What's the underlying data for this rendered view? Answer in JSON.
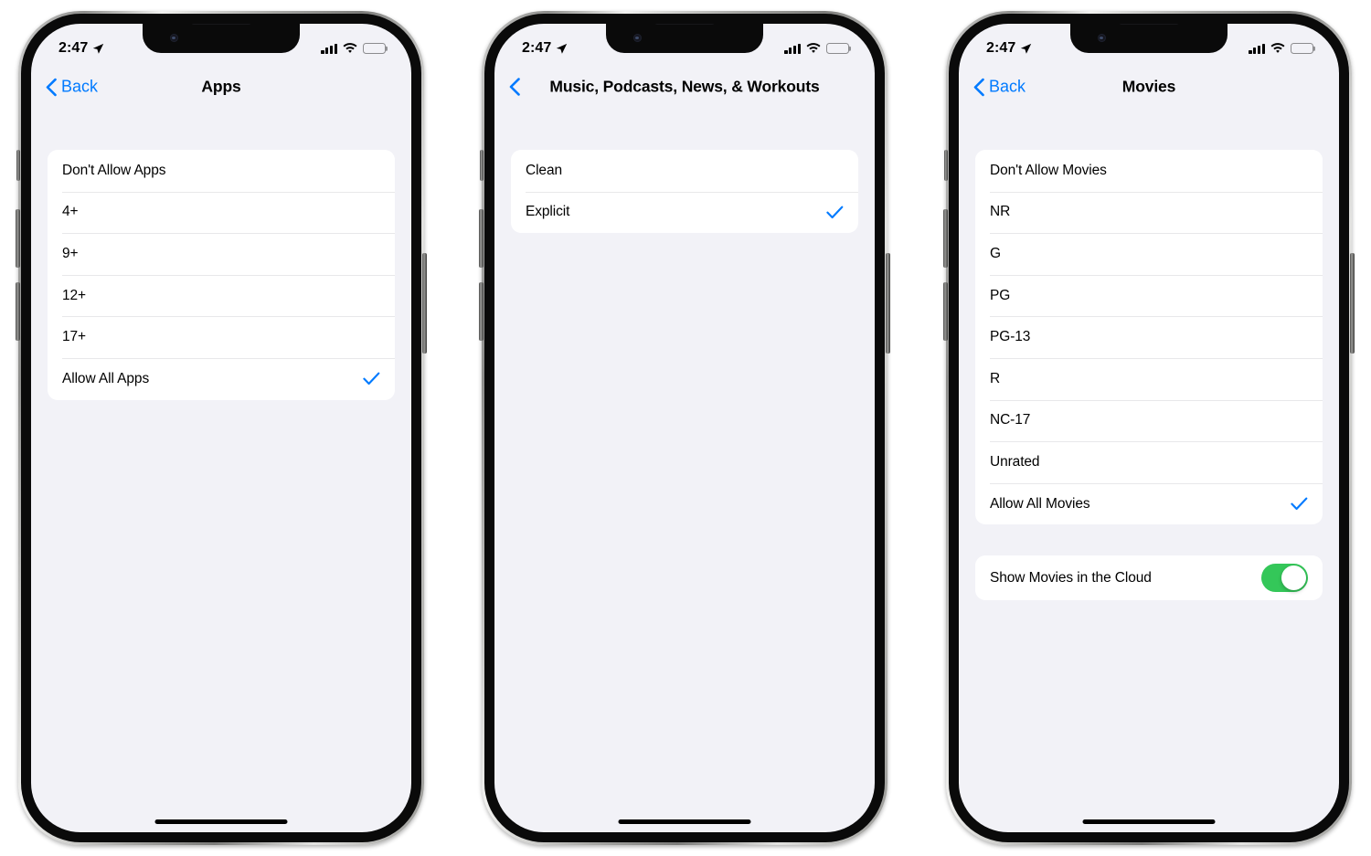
{
  "colors": {
    "accent_blue": "#007AFF",
    "toggle_green": "#34C759",
    "screen_background": "#F2F2F7",
    "card_white": "#FFFFFF",
    "text_primary": "#000000",
    "divider": "#E8E8EA"
  },
  "status_bar": {
    "time": "2:47",
    "location_icon": "location-arrow-icon",
    "signal_icon": "cellular-signal-icon",
    "signal_bars": 4,
    "wifi_icon": "wifi-icon",
    "battery_icon": "battery-full-icon",
    "battery_level": 100
  },
  "phones": [
    {
      "id": "phone-apps",
      "nav": {
        "back_label": "Back",
        "show_back_label": true,
        "back_icon": "chevron-left-icon",
        "title": "Apps"
      },
      "sections": [
        {
          "id": "apps-rating-list",
          "rows": [
            {
              "label": "Don't Allow Apps",
              "selected": false
            },
            {
              "label": "4+",
              "selected": false
            },
            {
              "label": "9+",
              "selected": false
            },
            {
              "label": "12+",
              "selected": false
            },
            {
              "label": "17+",
              "selected": false
            },
            {
              "label": "Allow All Apps",
              "selected": true
            }
          ]
        }
      ]
    },
    {
      "id": "phone-music",
      "nav": {
        "back_label": "",
        "show_back_label": false,
        "back_icon": "chevron-left-icon",
        "title": "Music, Podcasts, News, & Workouts"
      },
      "sections": [
        {
          "id": "music-rating-list",
          "rows": [
            {
              "label": "Clean",
              "selected": false
            },
            {
              "label": "Explicit",
              "selected": true
            }
          ]
        }
      ]
    },
    {
      "id": "phone-movies",
      "nav": {
        "back_label": "Back",
        "show_back_label": true,
        "back_icon": "chevron-left-icon",
        "title": "Movies"
      },
      "sections": [
        {
          "id": "movies-rating-list",
          "rows": [
            {
              "label": "Don't Allow Movies",
              "selected": false
            },
            {
              "label": "NR",
              "selected": false
            },
            {
              "label": "G",
              "selected": false
            },
            {
              "label": "PG",
              "selected": false
            },
            {
              "label": "PG-13",
              "selected": false
            },
            {
              "label": "R",
              "selected": false
            },
            {
              "label": "NC-17",
              "selected": false
            },
            {
              "label": "Unrated",
              "selected": false
            },
            {
              "label": "Allow All Movies",
              "selected": true
            }
          ]
        }
      ],
      "toggle_row": {
        "label": "Show Movies in the Cloud",
        "value": true
      }
    }
  ]
}
